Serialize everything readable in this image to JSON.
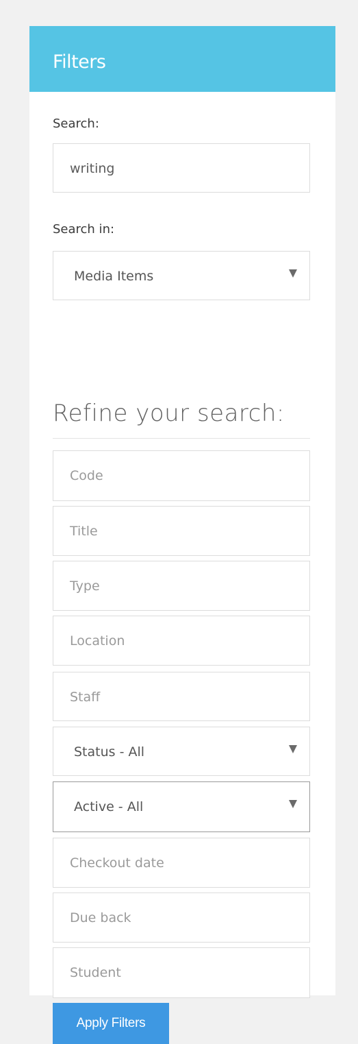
{
  "panel": {
    "title": "Filters"
  },
  "search": {
    "label": "Search:",
    "value": "writing"
  },
  "search_in": {
    "label": "Search in:",
    "selected": "Media Items"
  },
  "refine": {
    "heading": "Refine your search:"
  },
  "filters": {
    "code_placeholder": "Code",
    "title_placeholder": "Title",
    "type_placeholder": "Type",
    "location_placeholder": "Location",
    "staff_placeholder": "Staff",
    "status_selected": "Status - All",
    "active_selected": "Active - All",
    "checkout_date_placeholder": "Checkout date",
    "due_back_placeholder": "Due back",
    "student_placeholder": "Student"
  },
  "actions": {
    "apply_label": "Apply Filters"
  },
  "icons": {
    "dropdown": "caret-down-icon"
  },
  "colors": {
    "header_bg": "#55c4e4",
    "button_bg": "#3e98e2",
    "page_bg": "#f1f1f1"
  }
}
